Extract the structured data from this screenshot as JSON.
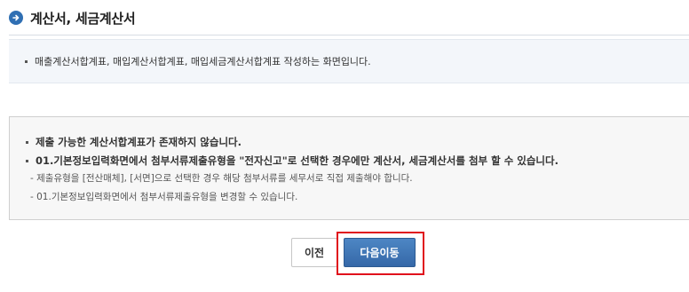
{
  "header": {
    "title": "계산서, 세금계산서",
    "icon": "arrow-right-circle-icon",
    "accent_color": "#2f6fb3"
  },
  "description": {
    "text": "매출계산서합계표, 매입계산서합계표, 매입세금계산서합계표 작성하는 화면입니다."
  },
  "notice": {
    "line1": "제출 가능한 계산서합계표가 존재하지 않습니다.",
    "line2": "01.기본정보입력화면에서 첨부서류제출유형을 \"전자신고\"로 선택한 경우에만 계산서, 세금계산서를 첨부 할 수 있습니다.",
    "sub1": "- 제출유형을 [전산매체], [서면]으로 선택한 경우 해당 첨부서류를 세무서로 직접 제출해야 합니다.",
    "sub2": "- 01.기본정보입력화면에서 첨부서류제출유형을 변경할 수 있습니다."
  },
  "buttons": {
    "prev_label": "이전",
    "next_label": "다음이동",
    "next_color": "#3c74b4",
    "highlight_color": "#e0101c"
  }
}
